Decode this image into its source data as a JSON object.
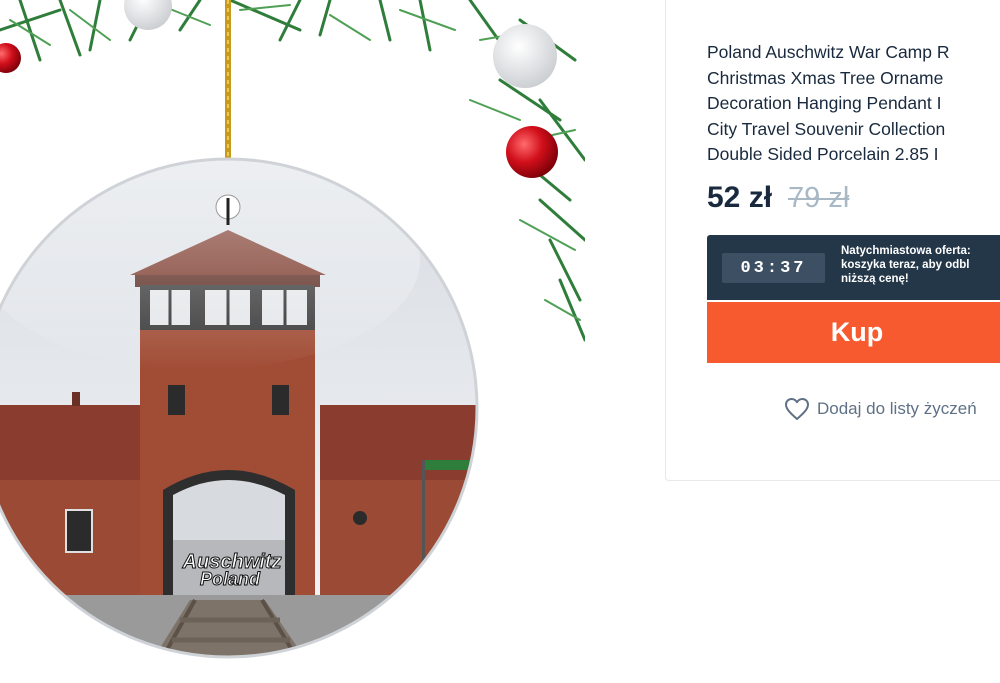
{
  "product": {
    "title_lines": [
      "Poland Auschwitz War Camp R",
      "Christmas Xmas Tree Orname",
      "Decoration Hanging Pendant I",
      "City Travel Souvenir Collection",
      "Double Sided Porcelain 2.85 I"
    ],
    "image_caption_line1": "Auschwitz",
    "image_caption_line2": "Poland",
    "icons": [
      "heart-icon"
    ]
  },
  "price": {
    "current": "52 zł",
    "original": "79 zł"
  },
  "offer": {
    "timer": "03:37",
    "text_lines": [
      "Natychmiastowa oferta:",
      "koszyka teraz, aby odbl",
      "niższą cenę!"
    ]
  },
  "actions": {
    "buy_label": "Kup",
    "wishlist_label": "Dodaj do listy życzeń"
  },
  "colors": {
    "accent": "#f75a2e",
    "dark": "#233749",
    "text": "#192a3e",
    "muted": "#a9b8c5"
  }
}
